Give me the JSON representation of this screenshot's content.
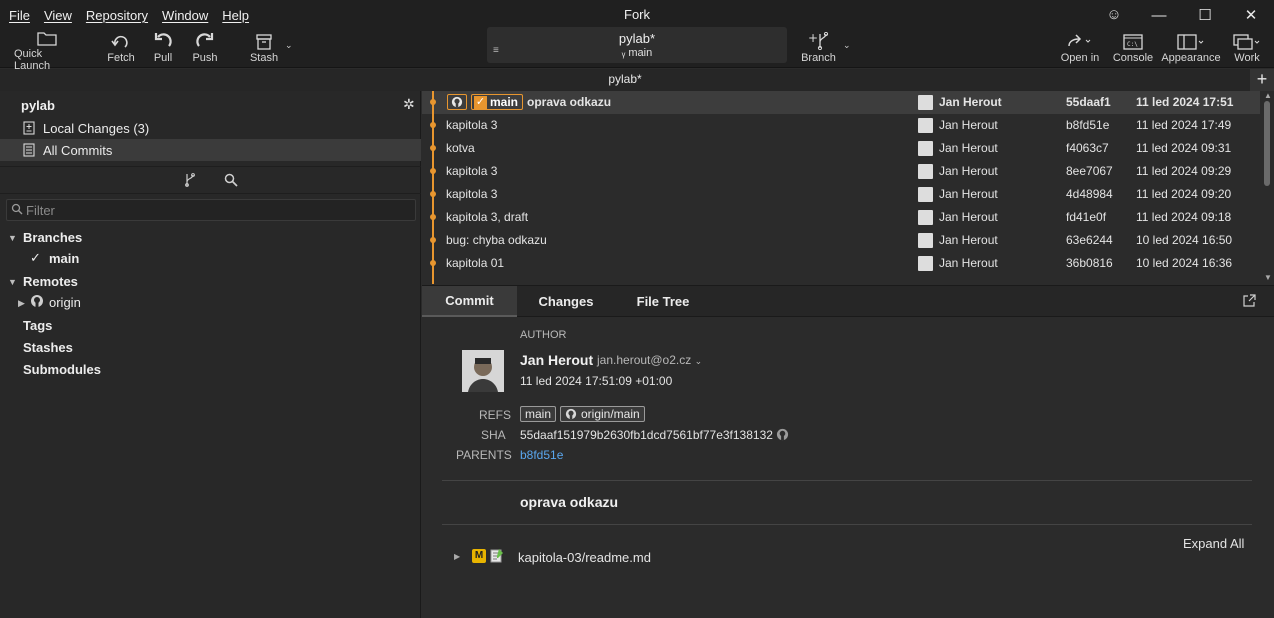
{
  "menu": [
    "File",
    "View",
    "Repository",
    "Window",
    "Help"
  ],
  "app_title": "Fork",
  "window_controls": {
    "minimize": "—",
    "maximize": "☐",
    "close": "✕"
  },
  "toolbar": {
    "quick_launch": "Quick Launch",
    "fetch": "Fetch",
    "pull": "Pull",
    "push": "Push",
    "stash": "Stash",
    "branch": "Branch",
    "open_in": "Open in",
    "console": "Console",
    "appearance": "Appearance",
    "work": "Work",
    "repo": {
      "name": "pylab*",
      "branch": "main"
    }
  },
  "tab": {
    "title": "pylab*"
  },
  "sidebar": {
    "repo_name": "pylab",
    "local_changes": "Local Changes (3)",
    "all_commits": "All Commits",
    "filter_placeholder": "Filter",
    "branches_header": "Branches",
    "branch_main": "main",
    "remotes_header": "Remotes",
    "remote_origin": "origin",
    "tags": "Tags",
    "stashes": "Stashes",
    "submodules": "Submodules"
  },
  "commits": [
    {
      "message": "oprava odkazu",
      "author": "Jan Herout",
      "sha": "55daaf1",
      "date": "11 led 2024 17:51",
      "refs": [
        "main"
      ]
    },
    {
      "message": "kapitola 3",
      "author": "Jan Herout",
      "sha": "b8fd51e",
      "date": "11 led 2024 17:49"
    },
    {
      "message": "kotva",
      "author": "Jan Herout",
      "sha": "f4063c7",
      "date": "11 led 2024 09:31"
    },
    {
      "message": "kapitola 3",
      "author": "Jan Herout",
      "sha": "8ee7067",
      "date": "11 led 2024 09:29"
    },
    {
      "message": "kapitola 3",
      "author": "Jan Herout",
      "sha": "4d48984",
      "date": "11 led 2024 09:20"
    },
    {
      "message": "kapitola 3, draft",
      "author": "Jan Herout",
      "sha": "fd41e0f",
      "date": "11 led 2024 09:18"
    },
    {
      "message": "bug: chyba odkazu",
      "author": "Jan Herout",
      "sha": "63e6244",
      "date": "10 led 2024 16:50"
    },
    {
      "message": "kapitola 01",
      "author": "Jan Herout",
      "sha": "36b0816",
      "date": "10 led 2024 16:36"
    }
  ],
  "detail": {
    "tabs": [
      "Commit",
      "Changes",
      "File Tree"
    ],
    "author_label": "AUTHOR",
    "author_name": "Jan Herout",
    "author_email": "jan.herout@o2.cz",
    "author_date": "11 led 2024 17:51:09 +01:00",
    "refs_label": "REFS",
    "refs": [
      "main",
      "origin/main"
    ],
    "sha_label": "SHA",
    "sha": "55daaf151979b2630fb1dcd7561bf77e3f138132",
    "parents_label": "PARENTS",
    "parent": "b8fd51e",
    "message": "oprava odkazu",
    "expand_all": "Expand All",
    "file": "kapitola-03/readme.md"
  },
  "colors": {
    "accent": "#e8962f",
    "link": "#5aa7ef",
    "background": "#2b2b2b"
  }
}
